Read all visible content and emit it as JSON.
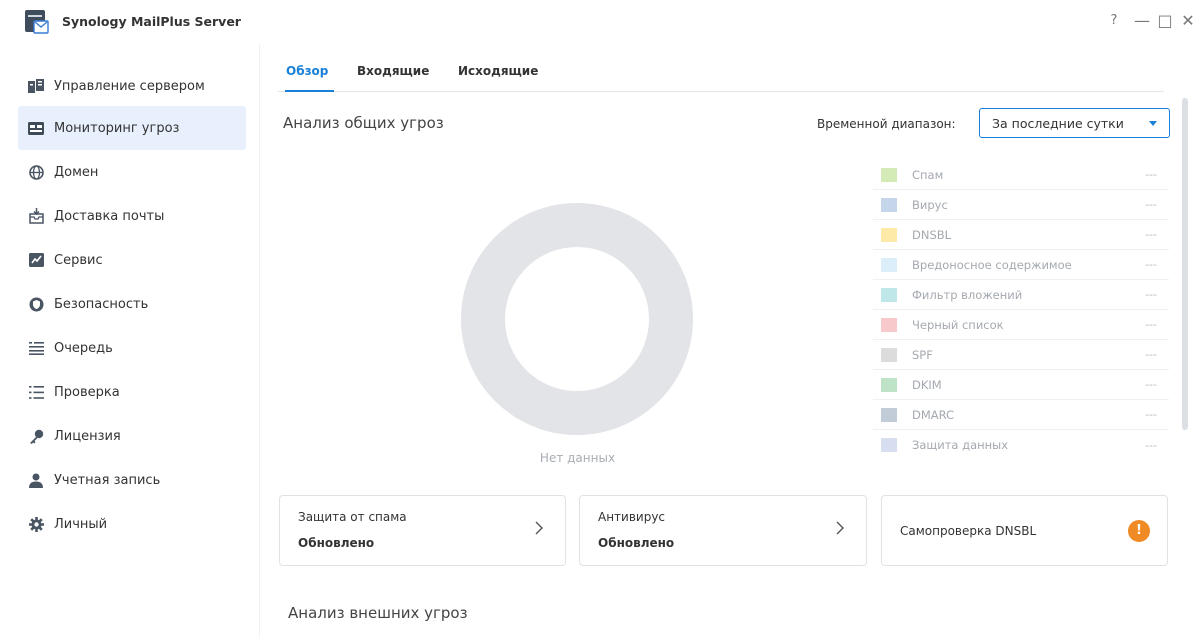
{
  "window": {
    "title": "Synology MailPlus Server",
    "controls": {
      "help": "?",
      "minimize": "—",
      "maximize": "□",
      "close": "✕"
    }
  },
  "sidebar": {
    "items": [
      {
        "label": "Управление сервером",
        "icon": "server-management-icon"
      },
      {
        "label": "Мониторинг угроз",
        "icon": "threat-monitor-icon",
        "active": true
      },
      {
        "label": "Домен",
        "icon": "globe-icon"
      },
      {
        "label": "Доставка почты",
        "icon": "mail-delivery-icon"
      },
      {
        "label": "Сервис",
        "icon": "service-icon"
      },
      {
        "label": "Безопасность",
        "icon": "shield-icon"
      },
      {
        "label": "Очередь",
        "icon": "queue-icon"
      },
      {
        "label": "Проверка",
        "icon": "list-check-icon"
      },
      {
        "label": "Лицензия",
        "icon": "key-icon"
      },
      {
        "label": "Учетная запись",
        "icon": "user-icon"
      },
      {
        "label": "Личный",
        "icon": "gear-icon"
      }
    ]
  },
  "tabs": [
    {
      "label": "Обзор",
      "active": true
    },
    {
      "label": "Входящие"
    },
    {
      "label": "Исходящие"
    }
  ],
  "overview": {
    "title": "Анализ общих угроз",
    "range_label": "Временной диапазон:",
    "range_value": "За последние сутки",
    "no_data": "Нет данных",
    "legend": [
      {
        "label": "Спам",
        "value": "---",
        "color": "#d4ebb8"
      },
      {
        "label": "Вирус",
        "value": "---",
        "color": "#c5d6ea"
      },
      {
        "label": "DNSBL",
        "value": "---",
        "color": "#fde9a8"
      },
      {
        "label": "Вредоносное содержимое",
        "value": "---",
        "color": "#dceefa"
      },
      {
        "label": "Фильтр вложений",
        "value": "---",
        "color": "#bfe6e8"
      },
      {
        "label": "Черный список",
        "value": "---",
        "color": "#f7c9cb"
      },
      {
        "label": "SPF",
        "value": "---",
        "color": "#dcdcdc"
      },
      {
        "label": "DKIM",
        "value": "---",
        "color": "#bfe3c7"
      },
      {
        "label": "DMARC",
        "value": "---",
        "color": "#c2ccd8"
      },
      {
        "label": "Защита данных",
        "value": "---",
        "color": "#d7deef"
      }
    ]
  },
  "cards": [
    {
      "title": "Защита от спама",
      "status": "Обновлено"
    },
    {
      "title": "Антивирус",
      "status": "Обновлено"
    },
    {
      "title": "Самопроверка DNSBL",
      "badge": "!"
    }
  ],
  "external": {
    "title": "Анализ внешних угроз"
  },
  "colors": {
    "accent": "#1a7fd7",
    "active_nav_bg": "#e7f0fc",
    "donut": "#e2e4e7",
    "warning": "#f08a24"
  }
}
